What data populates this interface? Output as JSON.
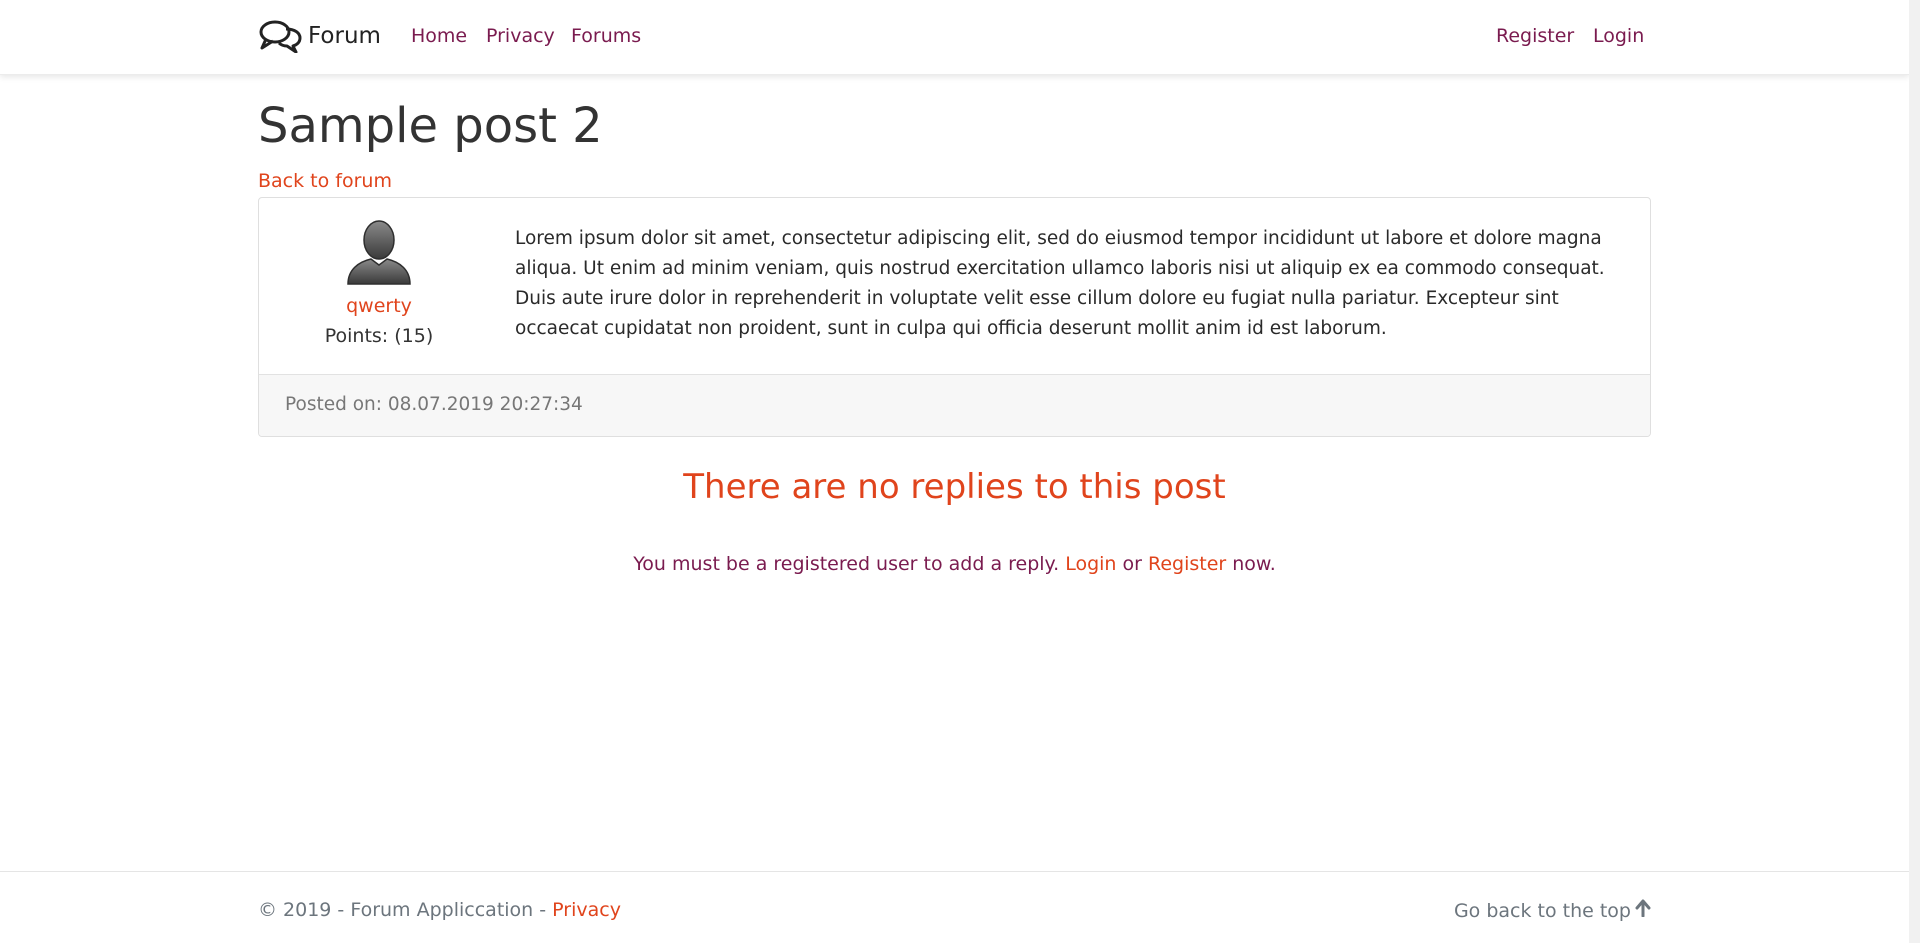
{
  "header": {
    "brand": "Forum",
    "nav": {
      "home": "Home",
      "privacy": "Privacy",
      "forums": "Forums",
      "register": "Register",
      "login": "Login"
    }
  },
  "post": {
    "title": "Sample post 2",
    "back_link": "Back to forum",
    "author": {
      "name": "qwerty",
      "points": "Points: (15)"
    },
    "body": "Lorem ipsum dolor sit amet, consectetur adipiscing elit, sed do eiusmod tempor incididunt ut labore et dolore magna aliqua. Ut enim ad minim veniam, quis nostrud exercitation ullamco laboris nisi ut aliquip ex ea commodo consequat. Duis aute irure dolor in reprehenderit in voluptate velit esse cillum dolore eu fugiat nulla pariatur. Excepteur sint occaecat cupidatat non proident, sunt in culpa qui officia deserunt mollit anim id est laborum.",
    "posted_on": "Posted on: 08.07.2019 20:27:34"
  },
  "replies": {
    "empty_message": "There are no replies to this post",
    "note_prefix": "You must be a registered user to add a reply.",
    "login": "Login",
    "or": "or",
    "register": "Register",
    "note_suffix": "now."
  },
  "footer": {
    "copyright": "© 2019 - Forum Appliccation -",
    "privacy": "Privacy",
    "back_to_top": "Go back to the top",
    "back_to_top_icon": "arrow-up-icon"
  },
  "colors": {
    "accent": "#e0441c",
    "nav_link": "#7a1b4f",
    "muted": "#6c757d"
  }
}
